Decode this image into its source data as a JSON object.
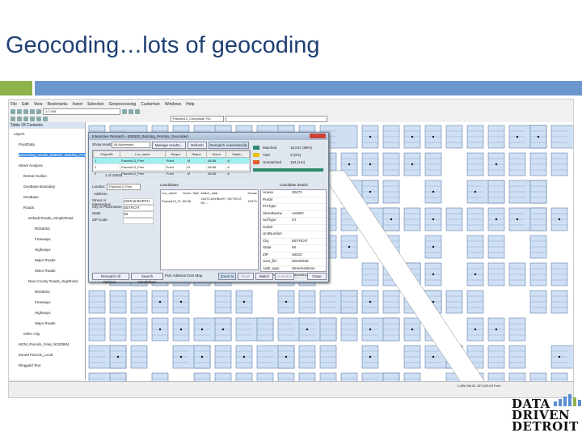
{
  "slide": {
    "title": "Geocoding…lots of geocoding"
  },
  "app": {
    "menu": [
      "File",
      "Edit",
      "View",
      "Bookmarks",
      "Insert",
      "Selection",
      "Geoprocessing",
      "Customize",
      "Windows",
      "Help"
    ],
    "scale": "1:7,946",
    "geocoder": "Parcels13_Composite_Ro",
    "toc_title": "Table Of Contents",
    "toc": [
      "Layers",
      "PointData",
      "geocoding_results_BSEED_Building_Permits",
      "Street Analysis",
      "Detroit Outline",
      "GeoBase Boundary",
      "GeoBase",
      "Roads",
      "Default Roads_SimpleRoad",
      "RDNDSC",
      "Freeways",
      "Highways",
      "Major Roads",
      "Minor Roads",
      "New County Roads_SignRoad",
      "RDNDSC",
      "Freeways",
      "Highways",
      "Major Roads",
      "Other City",
      "MCM_Parcels_Final_NOZ0804",
      "Zoned Parcels_Local",
      "Ringgold Text"
    ],
    "status": "1,495,096.61  437,629.63 Feet"
  },
  "dialog": {
    "title": "Interactive Rematch - BSEED_Building_Permits_Geocoded",
    "show_results_label": "Show results:",
    "show_results_value": "All Addresses",
    "buttons": {
      "manage": "Manage results...",
      "refresh": "Refresh",
      "auto": "Rematch Automatically",
      "rematch_all": "Rematch All Options...",
      "search": "Search Candidates",
      "pick": "Pick Address from Map",
      "zoom": "Zoom to",
      "flash": "Flash",
      "match": "Match",
      "unmatch": "Unmatch",
      "save": "Save Edits",
      "close": "Close"
    },
    "table_headers": [
      "ObjectID",
      "Loc_name",
      "Shape",
      "Status",
      "Score",
      "Match_"
    ],
    "rows": [
      [
        "1",
        "Parcels13_Prim",
        "Point",
        "M",
        "88.86",
        "A"
      ],
      [
        "2",
        "Parcels13_Prim",
        "Point",
        "M",
        "88.86",
        "A"
      ],
      [
        "3",
        "Parcels13_Prim",
        "Point",
        "M",
        "88.86",
        "A"
      ]
    ],
    "record_nav": "1  of 15040",
    "stats": [
      {
        "label": "Matched",
        "value": "15,041 (99%)",
        "color": "#2e8a6e"
      },
      {
        "label": "Tied",
        "value": "3 (0%)",
        "color": "#e8c000"
      },
      {
        "label": "Unmatched",
        "value": "153 (1%)",
        "color": "#e06030"
      }
    ],
    "match_progress": 0.99,
    "locator_label": "Locator:",
    "locator_value": "Parcels13_Prim",
    "address_label": "Address",
    "fields": [
      [
        "Street or Intersection",
        "3349 W BARTH"
      ],
      [
        "City or Placename",
        "DETROIT"
      ],
      [
        "State",
        "MI"
      ],
      [
        "ZIP Code",
        ""
      ]
    ],
    "candidates_title": "Candidates",
    "cand_headers": [
      "Loc_name",
      "Score",
      "Side",
      "Match_addr",
      "House"
    ],
    "cand_row": [
      "Parcels13_Pr",
      "88.86",
      "",
      "20473 ASHBURY, DETROIT, MI, ...",
      "20473"
    ],
    "details_title": "Candidate details",
    "details": [
      [
        "House",
        "20473"
      ],
      [
        "PreDir",
        ""
      ],
      [
        "PreType",
        ""
      ],
      [
        "StreetName",
        "ASHBY"
      ],
      [
        "SufType",
        "ST"
      ],
      [
        "SufDir",
        ""
      ],
      [
        "UnitNumber",
        ""
      ],
      [
        "City",
        "DETROIT"
      ],
      [
        "State",
        "MI"
      ],
      [
        "ZIP",
        "48223"
      ],
      [
        "User_fld",
        "5204004R"
      ],
      [
        "Addr_type",
        "StreetAddress"
      ],
      [
        "Loc_name",
        "Parcels13_Prim"
      ]
    ]
  },
  "logo": {
    "lines": [
      "DATA",
      "DRIVEN",
      "DETROIT"
    ],
    "bar_color": "#5b8fd0",
    "bar_color2": "#8db34a"
  }
}
